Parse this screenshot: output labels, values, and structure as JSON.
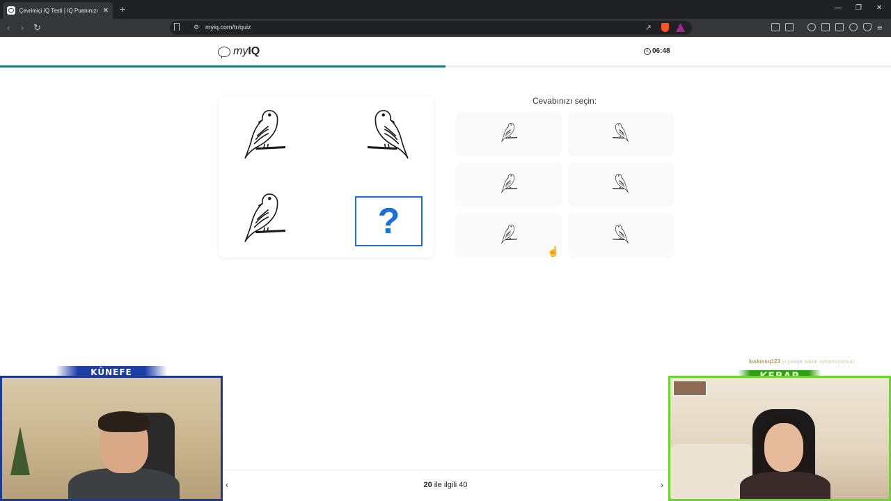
{
  "browser": {
    "tab_title": "Çevrimiçi IQ Testi | IQ Puanınızı K",
    "tab_close": "✕",
    "new_tab": "+",
    "url": "myiq.com/tr/quiz",
    "window_controls": [
      "—",
      "❐",
      "✕"
    ]
  },
  "header": {
    "logo_my": "my",
    "logo_iq": "IQ",
    "timer": "06:48",
    "progress_fraction": 0.5
  },
  "quiz": {
    "prompt": "Cevabınızı seçin:",
    "question_mark": "?",
    "matrix": [
      {
        "icon": "bird-facing-right-icon",
        "flip": false
      },
      {
        "icon": "bird-facing-left-icon",
        "flip": true
      },
      {
        "icon": "bird-facing-right-icon",
        "flip": false
      }
    ],
    "options": [
      {
        "icon": "bird-icon",
        "flip": false
      },
      {
        "icon": "bird-icon",
        "flip": true
      },
      {
        "icon": "bird-icon",
        "flip": false
      },
      {
        "icon": "bird-icon",
        "flip": true
      },
      {
        "icon": "bird-icon",
        "flip": false
      },
      {
        "icon": "bird-icon",
        "flip": true
      }
    ]
  },
  "pager": {
    "current": "20",
    "middle": "ile ilgili",
    "total": "40",
    "prev": "‹",
    "next": "›"
  },
  "stream": {
    "left_banner": "KÜNEFE",
    "right_banner": "KEBAP",
    "chat_user": "kıskıssq123",
    "chat_text": "yı yaaşa sadaı oynamıyorsun"
  },
  "colors": {
    "accent": "#1a6fdb",
    "progress": "#1f7a76",
    "left_cam_border": "#1c3a8f",
    "right_cam_border": "#6bd62f"
  }
}
